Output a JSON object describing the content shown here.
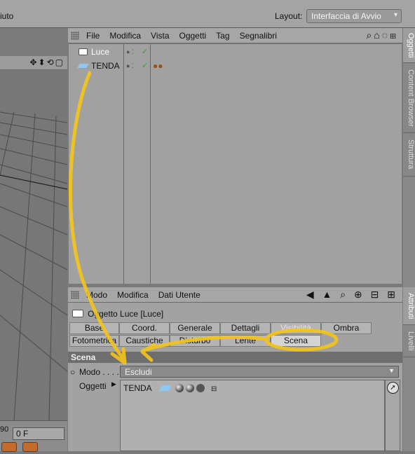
{
  "topbar": {
    "menu_fragment": "iuto",
    "layout_label": "Layout:",
    "layout_value": "Interfaccia di Avvio"
  },
  "viewport": {
    "frame_value": "0 F",
    "frame_fragment": "90"
  },
  "object_manager": {
    "menu": [
      "File",
      "Modifica",
      "Vista",
      "Oggetti",
      "Tag",
      "Segnalibri"
    ],
    "objects": [
      {
        "name": "Luce",
        "icon": "light-icon"
      },
      {
        "name": "TENDA",
        "icon": "plane-icon"
      }
    ]
  },
  "side_tabs": {
    "top": [
      "Oggetti",
      "Content Browser",
      "Struttura"
    ],
    "bottom": [
      "Attributi",
      "Livelli"
    ]
  },
  "attribute_manager": {
    "menu": [
      "Modo",
      "Modifica",
      "Dati Utente"
    ],
    "title": "Oggetto Luce [Luce]",
    "tabs_row1": [
      "Base",
      "Coord.",
      "Generale",
      "Dettagli",
      "Visibilità",
      "Ombra"
    ],
    "tabs_row2": [
      "Fotometrica",
      "Caustiche",
      "Disturbo",
      "Lente",
      "Scena"
    ],
    "section_title": "Scena",
    "modo_label": "Modo . . . .",
    "modo_value": "Escludi",
    "oggetti_label": "Oggetti",
    "list_item": "TENDA"
  },
  "colors": {
    "annotation": "#f5c518",
    "panel": "#a2a2a2"
  }
}
